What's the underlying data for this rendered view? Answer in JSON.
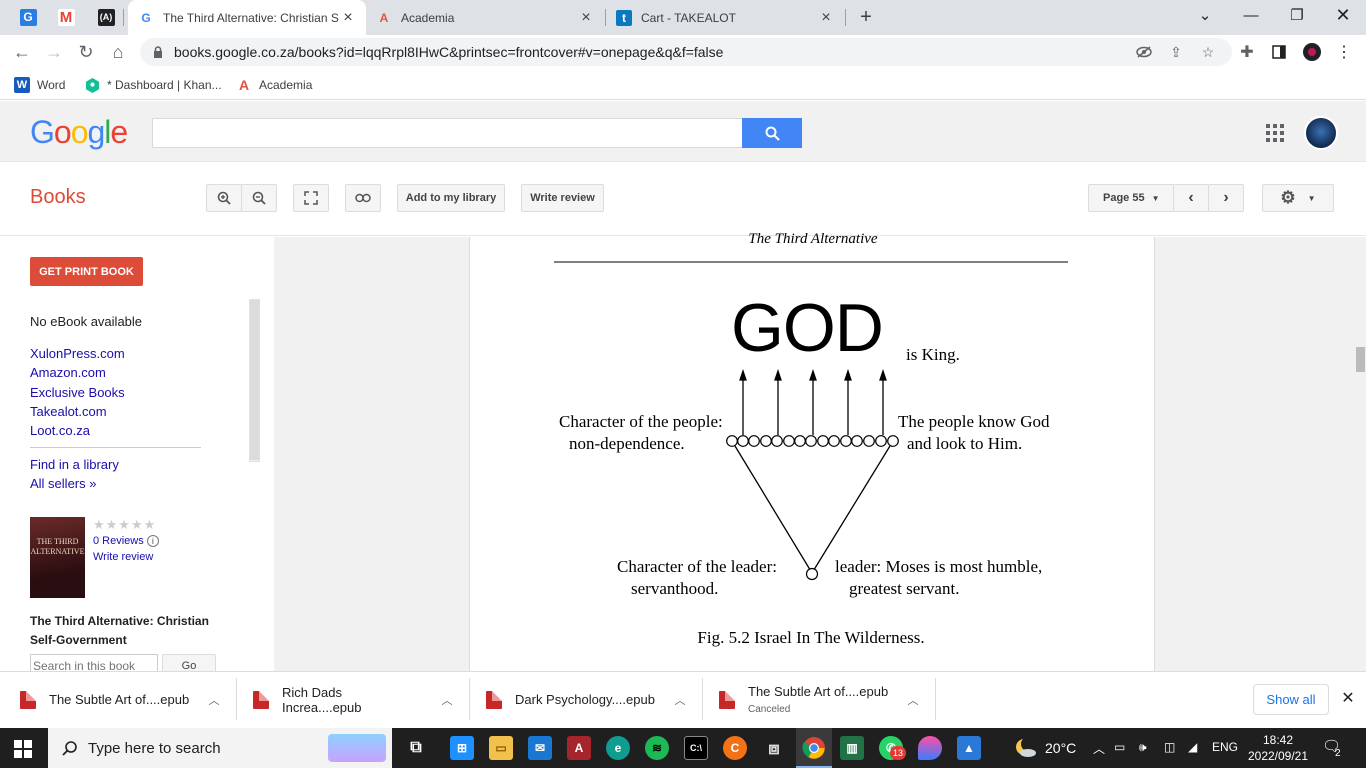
{
  "browser": {
    "pinned_tabs": [
      {
        "icon": "google-sites-icon",
        "letter": "G",
        "color": "#2a7de1"
      },
      {
        "icon": "gmail-icon",
        "letter": "M",
        "color": "#ea4335"
      },
      {
        "icon": "academia-mono-icon",
        "letter": "(A)",
        "color": "#202124"
      }
    ],
    "tabs": [
      {
        "title": "The Third Alternative: Christian S",
        "icon": "google-books-icon",
        "active": true
      },
      {
        "title": "Academia",
        "icon": "academia-icon",
        "active": false
      },
      {
        "title": "Cart - TAKEALOT",
        "icon": "takealot-icon",
        "active": false
      }
    ],
    "new_tab": "+",
    "url": "books.google.co.za/books?id=lqqRrpl8IHwC&printsec=frontcover#v=onepage&q&f=false",
    "bookmarks": [
      {
        "label": "Word",
        "icon": "word-icon",
        "color": "#185abd"
      },
      {
        "label": "* Dashboard | Khan...",
        "icon": "khan-academy-icon",
        "color": "#14bf96"
      },
      {
        "label": "Academia",
        "icon": "academia-icon",
        "color": "#e0533d"
      }
    ]
  },
  "google": {
    "logo": "Google",
    "search_value": ""
  },
  "books": {
    "label": "Books",
    "add_library": "Add to my library",
    "write_review": "Write review",
    "page_select": "Page 55"
  },
  "sidebar": {
    "get_print": "GET PRINT BOOK",
    "no_ebook": "No eBook available",
    "sellers": [
      "XulonPress.com",
      "Amazon.com",
      "Exclusive Books",
      "Takealot.com",
      "Loot.co.za"
    ],
    "find_library": "Find in a library",
    "all_sellers": "All sellers »",
    "cover_text": "THE THIRD ALTERNATIVE",
    "reviews": "0 Reviews",
    "write_review": "Write review",
    "book_title": "The Third Alternative: Christian Self-Government",
    "search_placeholder": "Search in this book",
    "go": "Go"
  },
  "page": {
    "running_header": "The Third Alternative",
    "god": "GOD",
    "is_king": "is King.",
    "left_people_1": "Character of the people:",
    "left_people_2": "non-dependence.",
    "right_people_1": "The people know God",
    "right_people_2": "and look to Him.",
    "left_leader_1": "Character of the leader:",
    "left_leader_2": "servanthood.",
    "right_leader_1": "leader: Moses is most humble,",
    "right_leader_2": "greatest servant.",
    "caption": "Fig. 5.2 Israel In The Wilderness."
  },
  "downloads": [
    {
      "name": "The Subtle Art of....epub",
      "status": ""
    },
    {
      "name": "Rich Dads Increa....epub",
      "status": ""
    },
    {
      "name": "Dark Psychology....epub",
      "status": ""
    },
    {
      "name": "The Subtle Art of....epub",
      "status": "Canceled"
    }
  ],
  "show_all": "Show all",
  "taskbar": {
    "search_placeholder": "Type here to search",
    "temperature": "20°C",
    "language": "ENG",
    "time": "18:42",
    "date": "2022/09/21",
    "whatsapp_badge": "13",
    "notifications": "2"
  }
}
